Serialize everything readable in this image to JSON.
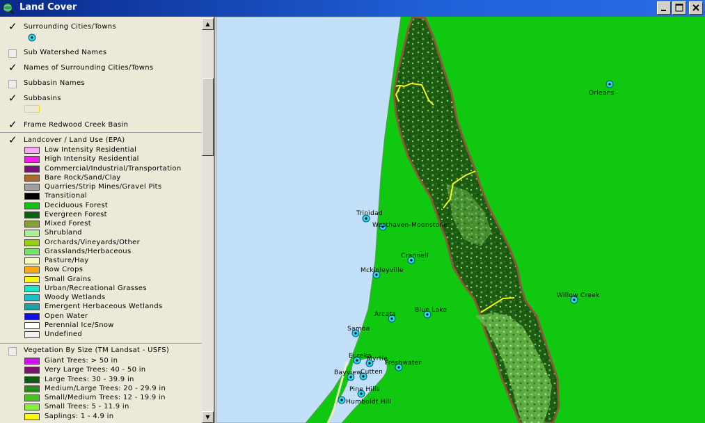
{
  "window": {
    "title": "Land Cover"
  },
  "toc": {
    "layers": {
      "surrounding_cities": {
        "label": "Surrounding Cities/Towns",
        "checked": true
      },
      "sub_watershed_names": {
        "label": "Sub Watershed Names",
        "checked": false
      },
      "names_surrounding": {
        "label": "Names of Surrounding Cities/Towns",
        "checked": true
      },
      "subbasin_names": {
        "label": "Subbasin Names",
        "checked": false
      },
      "subbasins": {
        "label": "Subbasins",
        "checked": true
      },
      "frame": {
        "label": "Frame Redwood Creek Basin",
        "checked": true
      },
      "landcover": {
        "label": "Landcover / Land Use (EPA)",
        "checked": true
      },
      "vegetation": {
        "label": "Vegetation By Size (TM Landsat - USFS)",
        "checked": false
      }
    },
    "landcover_classes": [
      {
        "label": "Low Intensity Residential",
        "color": "#f8a8f0"
      },
      {
        "label": "High Intensity Residential",
        "color": "#f020e8"
      },
      {
        "label": "Commercial/Industrial/Transportation",
        "color": "#78107a"
      },
      {
        "label": "Bare Rock/Sand/Clay",
        "color": "#a86830"
      },
      {
        "label": "Quarries/Strip Mines/Gravel Pits",
        "color": "#a0a0a0"
      },
      {
        "label": "Transitional",
        "color": "#000000"
      },
      {
        "label": "Deciduous Forest",
        "color": "#10c010"
      },
      {
        "label": "Evergreen Forest",
        "color": "#0a6010"
      },
      {
        "label": "Mixed Forest",
        "color": "#88a030"
      },
      {
        "label": "Shrubland",
        "color": "#a8f098"
      },
      {
        "label": "Orchards/Vineyards/Other",
        "color": "#98d010"
      },
      {
        "label": "Grasslands/Herbaceous",
        "color": "#78e070"
      },
      {
        "label": "Pasture/Hay",
        "color": "#f8f8c0"
      },
      {
        "label": "Row Crops",
        "color": "#f8a810"
      },
      {
        "label": "Small Grains",
        "color": "#f8f810"
      },
      {
        "label": "Urban/Recreational Grasses",
        "color": "#18e8c8"
      },
      {
        "label": "Woody Wetlands",
        "color": "#18c0c8"
      },
      {
        "label": "Emergent Herbaceous Wetlands",
        "color": "#20a0a0"
      },
      {
        "label": "Open Water",
        "color": "#1010e0"
      },
      {
        "label": "Perennial Ice/Snow",
        "color": "#ffffff"
      },
      {
        "label": "Undefined",
        "color": "#f0f0f0"
      }
    ],
    "vegetation_classes": [
      {
        "label": "Giant Trees: > 50 in",
        "color": "#d010f0"
      },
      {
        "label": "Very Large Trees: 40 - 50 in",
        "color": "#801070"
      },
      {
        "label": "Large Trees: 30 - 39.9 in",
        "color": "#0a6010"
      },
      {
        "label": "Medium/Large Trees: 20 - 29.9 in",
        "color": "#2a8a20"
      },
      {
        "label": "Small/Medium Trees: 12 - 19.9 in",
        "color": "#48c020"
      },
      {
        "label": "Small Trees: 5 - 11.9 in",
        "color": "#88f040"
      },
      {
        "label": "Saplings: 1 - 4.9 in",
        "color": "#f8f810"
      }
    ]
  },
  "map": {
    "colors": {
      "ocean": "#c2e0f8",
      "land": "#10c810",
      "forest": "#1d5a12",
      "subbasin_line": "#f8f810",
      "frame_line": "#8a5a3a"
    },
    "cities": [
      {
        "name": "Orleans"
      },
      {
        "name": "Trinidad"
      },
      {
        "name": "Westhaven-Moonstone"
      },
      {
        "name": "Crannell"
      },
      {
        "name": "Mckinleyville"
      },
      {
        "name": "Willow Creek"
      },
      {
        "name": "Arcata"
      },
      {
        "name": "Blue Lake"
      },
      {
        "name": "Samoa"
      },
      {
        "name": "Eureka"
      },
      {
        "name": "Myrtle"
      },
      {
        "name": "Freshwater"
      },
      {
        "name": "Bayview"
      },
      {
        "name": "Cutten"
      },
      {
        "name": "Pine Hills"
      },
      {
        "name": "Humboldt Hill"
      }
    ]
  }
}
